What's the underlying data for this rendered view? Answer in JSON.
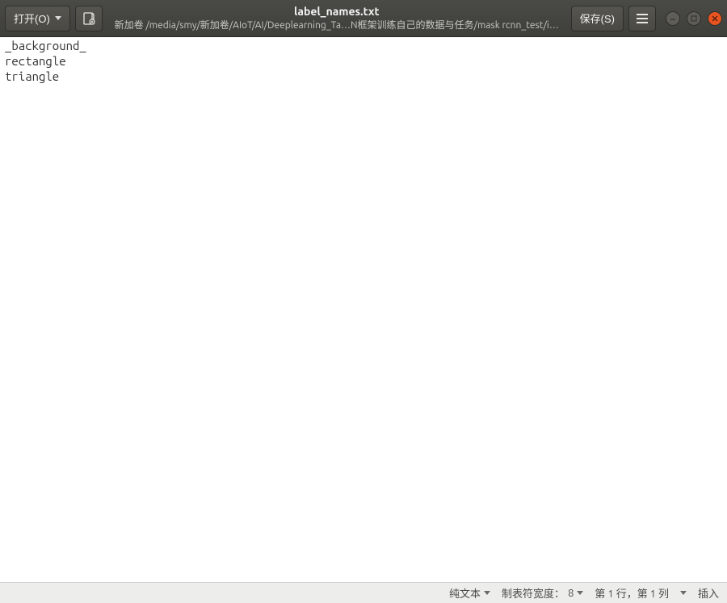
{
  "header": {
    "open_label": "打开(O)",
    "save_label": "保存(S)",
    "title": "label_names.txt",
    "subtitle": "新加卷 /media/smy/新加卷/AIoT/AI/Deeplearning_Ta…N框架训练自己的数据与任务/mask rcnn_test/i…"
  },
  "editor": {
    "lines": [
      "_background_",
      "rectangle",
      "triangle"
    ]
  },
  "statusbar": {
    "filetype_label": "纯文本",
    "tabwidth_label": "制表符宽度：",
    "tabwidth_value": "8",
    "position_label": "第 1 行，第 1 列",
    "insert_label": "插入"
  }
}
